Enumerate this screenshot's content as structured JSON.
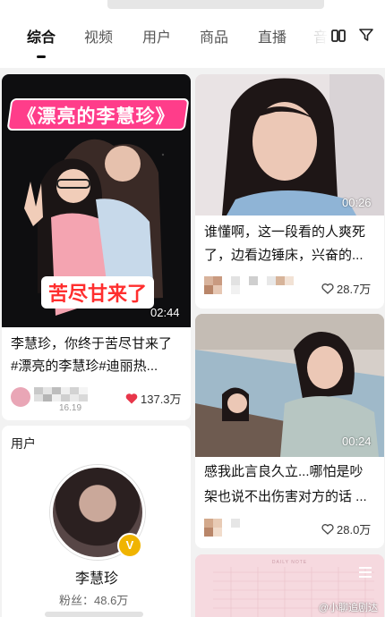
{
  "tabs": [
    "综合",
    "视频",
    "用户",
    "商品",
    "直播",
    "音"
  ],
  "cards": [
    {
      "cover_title": "《漂亮的李慧珍》",
      "cover_caption": "苦尽甘来了",
      "duration": "02:44",
      "title_line1": "李慧珍，你终于苦尽甘来了",
      "title_line2": "#漂亮的李慧珍#迪丽热...",
      "date_fragment": "16.19",
      "likes": "137.3万",
      "liked": true
    },
    {
      "duration": "00:26",
      "title_line1": "谁懂啊，这一段看的人爽死",
      "title_line2": "了，边看边锤床，兴奋的...",
      "likes": "28.7万",
      "liked": false
    },
    {
      "duration": "00:24",
      "title_line1": "感我此言良久立...哪怕是吵",
      "title_line2": "架也说不出伤害对方的话 ...",
      "likes": "28.0万",
      "liked": false
    },
    {
      "cover_text": "DAILY NOTE"
    }
  ],
  "user_section": {
    "label": "用户",
    "name": "李慧珍",
    "fans": "粉丝：48.6万",
    "verified_badge": "V"
  },
  "watermark": "@小聊追剧达",
  "colors": {
    "like_red": "#e8364a",
    "cover_pink": "#ff3d8a",
    "caption_red": "#ff2e2e"
  },
  "icons": [
    "book-icon",
    "filter-icon",
    "heart-icon",
    "heart-outline-icon",
    "verified-badge-icon"
  ]
}
